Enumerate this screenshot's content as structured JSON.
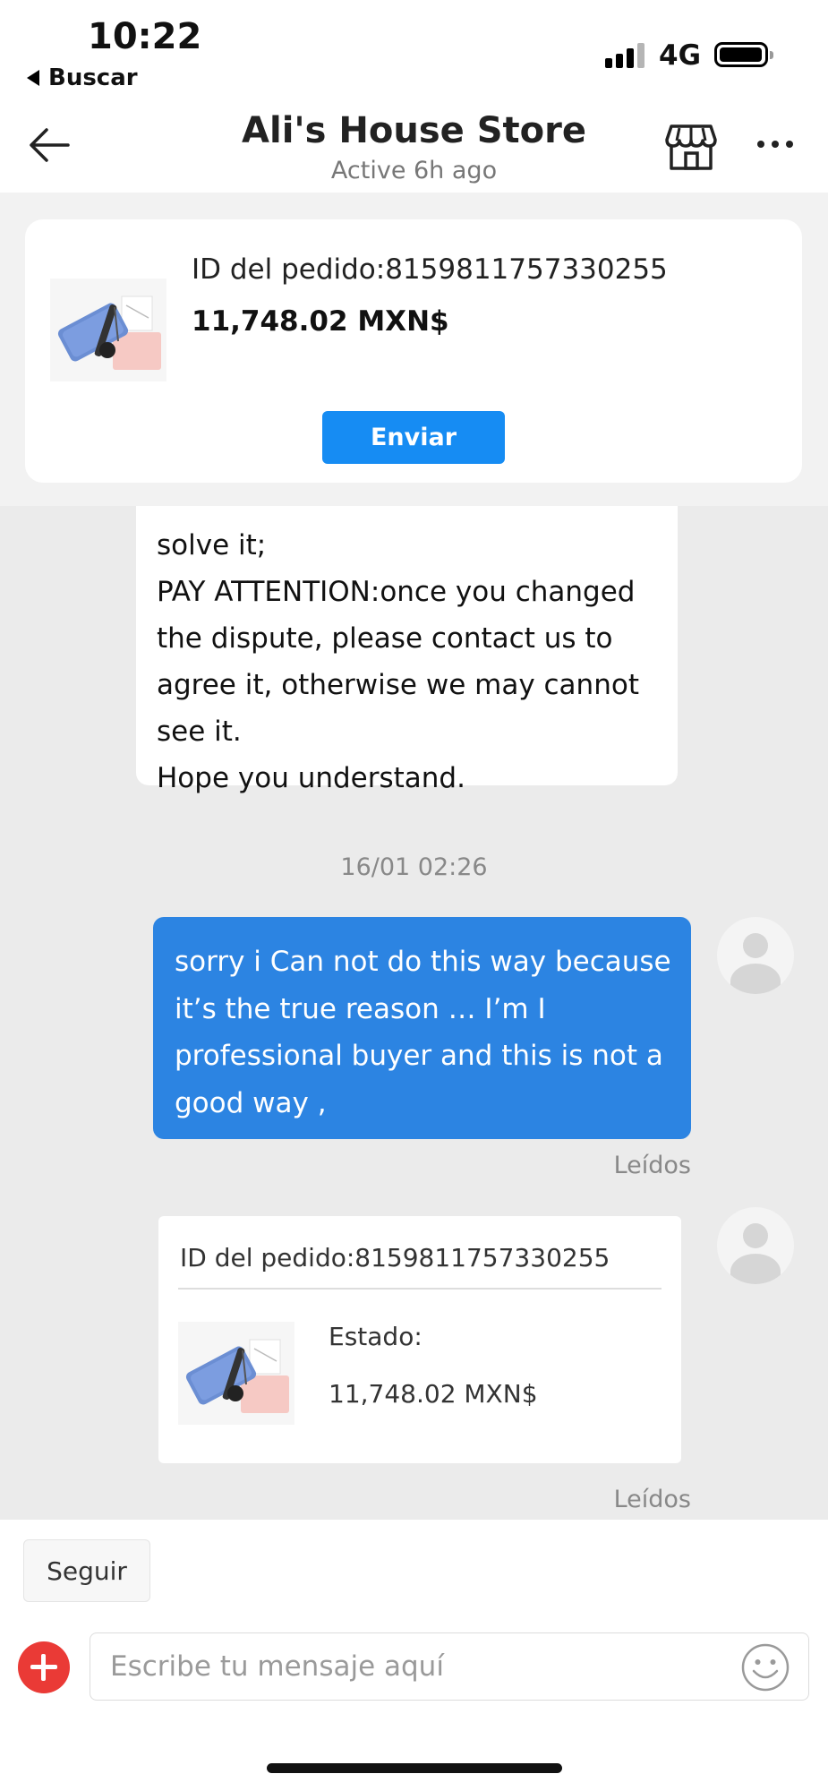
{
  "status_bar": {
    "time": "10:22",
    "back_app_label": "Buscar",
    "network": "4G",
    "signal_bars_active": 3
  },
  "header": {
    "title": "Ali's House Store",
    "subtitle": "Active 6h ago",
    "back_icon": "arrow-left-icon",
    "store_icon": "store-icon",
    "more_icon": "more-dots-icon"
  },
  "pinned_order": {
    "order_id": "ID del pedido:8159811757330255",
    "price": "11,748.02 MXN$",
    "send_label": "Enviar"
  },
  "messages": {
    "incoming_lines": [
      "solve it;",
      "PAY ATTENTION:once you changed",
      "the dispute, please contact us to",
      "agree it, otherwise we may cannot",
      "see it.",
      "Hope you understand."
    ],
    "timestamp": "16/01 02:26",
    "outgoing_lines": [
      "sorry i Can not do this way because",
      "it’s the true reason … I’m I",
      "professional buyer and this is not a",
      "good way ,"
    ],
    "read_label_1": "Leídos",
    "order_card": {
      "order_id": "ID del pedido:8159811757330255",
      "status_label": "Estado:",
      "price": "11,748.02 MXN$"
    },
    "read_label_2": "Leídos"
  },
  "bottom": {
    "follow_label": "Seguir",
    "input_placeholder": "Escribe tu mensaje aquí",
    "emoji_icon": "smiley-icon",
    "add_icon": "plus-icon"
  },
  "colors": {
    "accent_blue": "#168cf3",
    "bubble_blue": "#2c84e2",
    "add_red": "#ea3a36"
  }
}
